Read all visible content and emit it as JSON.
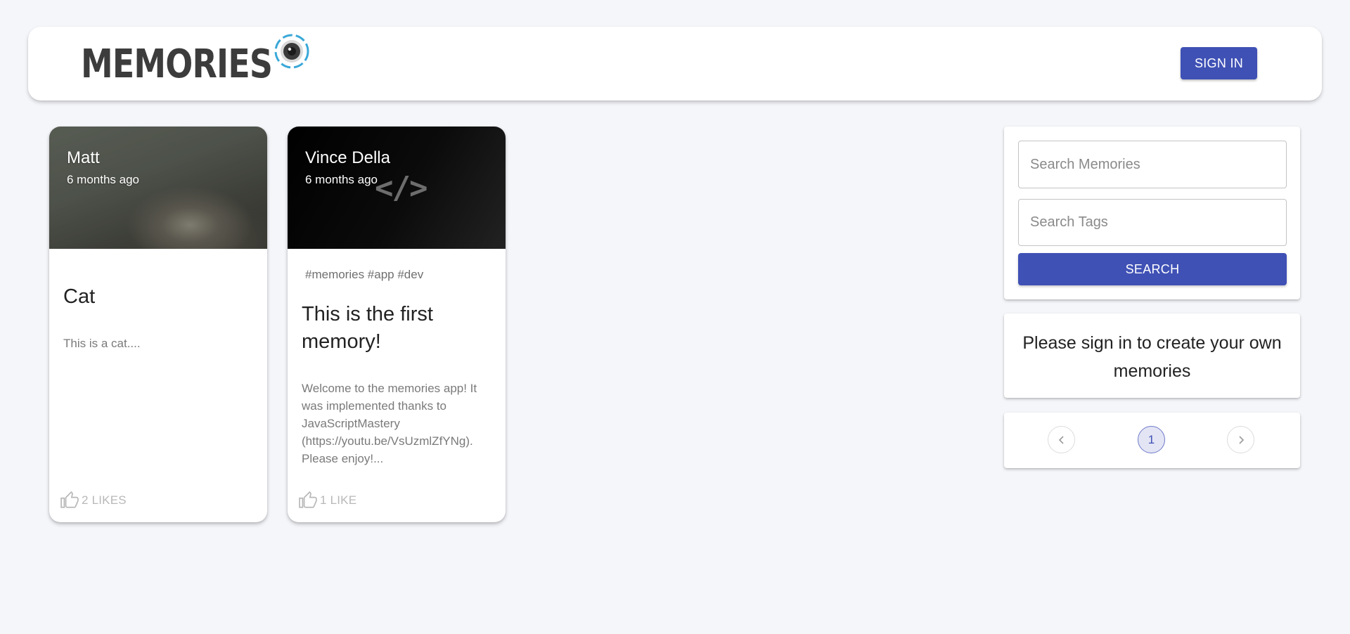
{
  "header": {
    "brand_title": "Memories",
    "sign_in_label": "SIGN IN",
    "accent_color": "#3f51b5"
  },
  "posts": [
    {
      "creator": "Matt",
      "time_ago": "6 months ago",
      "tags": "",
      "title": "Cat",
      "message": "This is a cat....",
      "likes_label": "2 LIKES"
    },
    {
      "creator": "Vince Della",
      "time_ago": "6 months ago",
      "media_glyph": "</>",
      "tags": "#memories #app #dev",
      "title": "This is the first memory!",
      "message": "Welcome to the memories app! It was implemented thanks to JavaScriptMastery (https://youtu.be/VsUzmlZfYNg). Please enjoy!...",
      "likes_label": "1 LIKE"
    }
  ],
  "search": {
    "memories_placeholder": "Search Memories",
    "tags_placeholder": "Search Tags",
    "button_label": "SEARCH"
  },
  "signin_prompt": "Please sign in to create your own memories",
  "pagination": {
    "current_page": "1"
  }
}
